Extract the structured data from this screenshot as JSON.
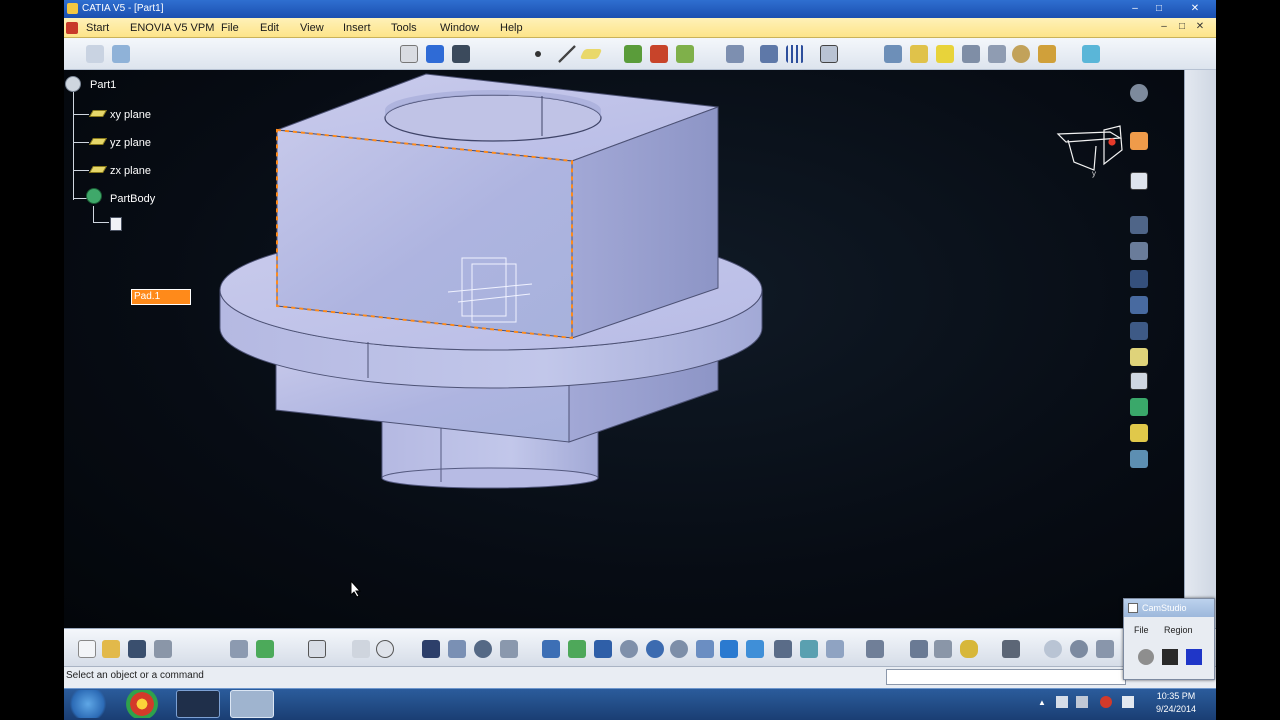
{
  "window": {
    "title": "CATIA V5 - [Part1]",
    "minimize": "–",
    "maximize": "□",
    "close": "✕"
  },
  "menu": {
    "items": [
      "Start",
      "ENOVIA V5 VPM",
      "File",
      "Edit",
      "View",
      "Insert",
      "Tools",
      "Window",
      "Help"
    ],
    "doc_min": "–",
    "doc_max": "□",
    "doc_close": "✕"
  },
  "tree": {
    "root": "Part1",
    "planes": [
      "xy plane",
      "yz plane",
      "zx plane"
    ],
    "body": "PartBody",
    "selected_feature": "Pad.1"
  },
  "compass": {
    "axis_label": "y"
  },
  "status": {
    "message": "Select an object or a command",
    "command_value": ""
  },
  "camstudio": {
    "title": "CamStudio",
    "menu": [
      "File",
      "Region"
    ]
  },
  "clock": {
    "time": "10:35 PM",
    "date": "9/24/2014"
  },
  "colors": {
    "part_face": "#b4b8e0",
    "part_side": "#9fa4d0",
    "selection": "#ff8a1a",
    "menubar": "#fde489",
    "titlebar": "#1b4fb0"
  }
}
